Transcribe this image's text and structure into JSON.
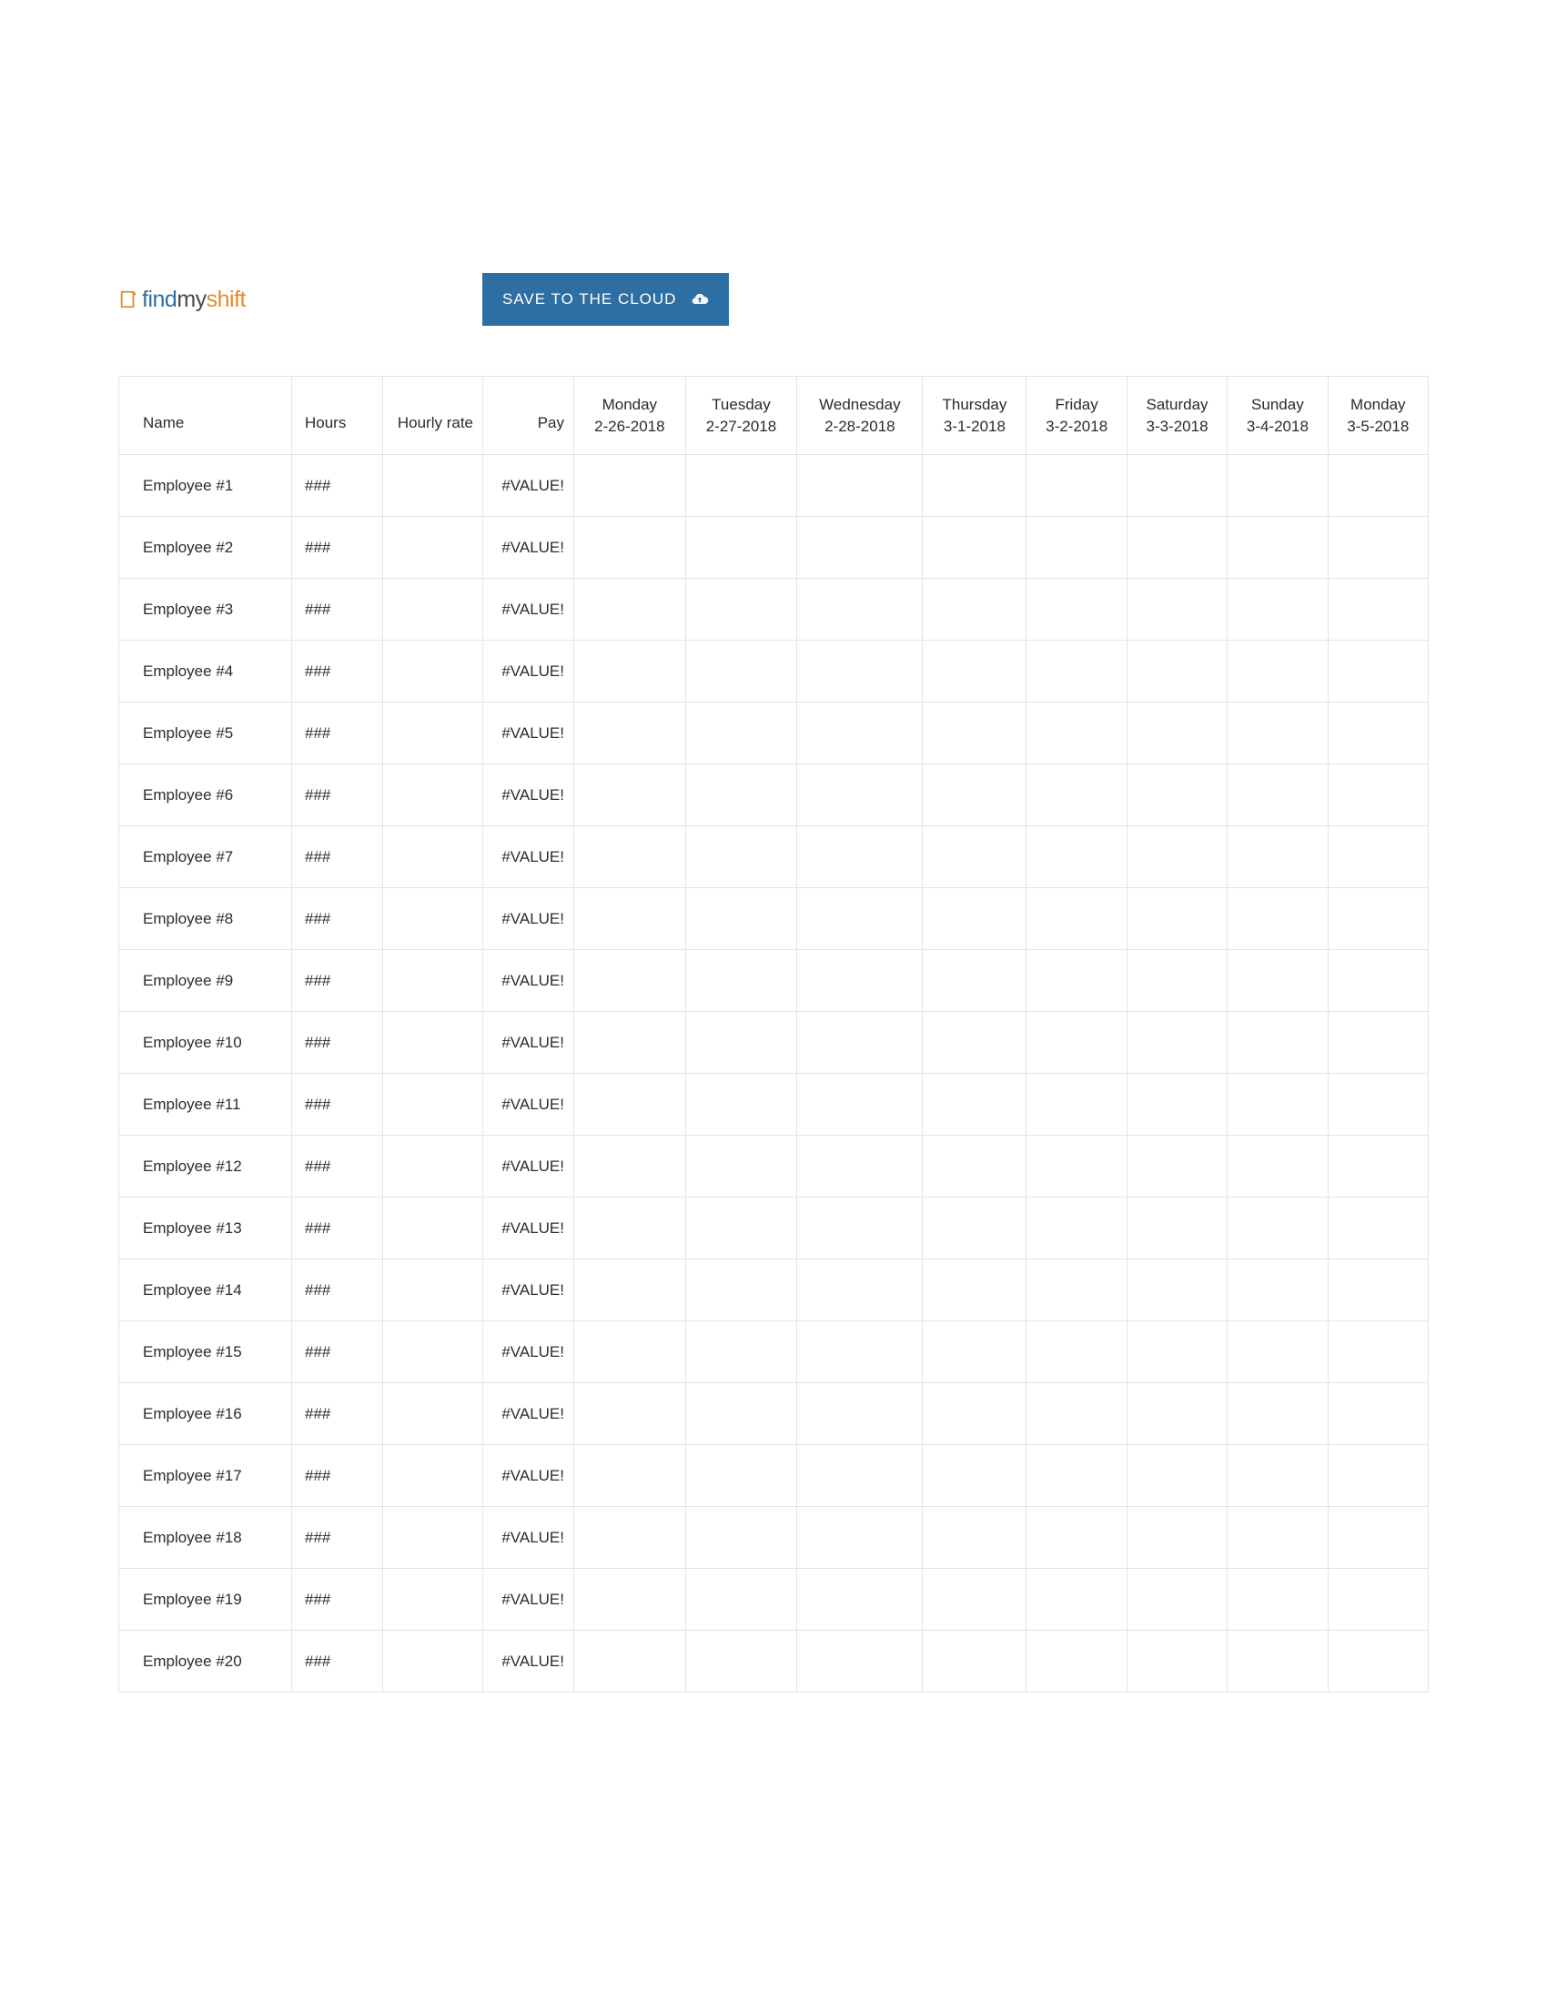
{
  "logo": {
    "part1": "find",
    "part2": "my",
    "part3": "shift"
  },
  "button": {
    "save_label": "SAVE TO THE CLOUD"
  },
  "table": {
    "headers": {
      "name": "Name",
      "hours": "Hours",
      "rate": "Hourly rate",
      "pay": "Pay"
    },
    "date_columns": [
      {
        "day": "Monday",
        "date": "2-26-2018"
      },
      {
        "day": "Tuesday",
        "date": "2-27-2018"
      },
      {
        "day": "Wednesday",
        "date": "2-28-2018"
      },
      {
        "day": "Thursday",
        "date": "3-1-2018"
      },
      {
        "day": "Friday",
        "date": "3-2-2018"
      },
      {
        "day": "Saturday",
        "date": "3-3-2018"
      },
      {
        "day": "Sunday",
        "date": "3-4-2018"
      },
      {
        "day": "Monday",
        "date": "3-5-2018"
      }
    ],
    "rows": [
      {
        "name": "Employee #1",
        "hours": "###",
        "rate": "",
        "pay": "#VALUE!"
      },
      {
        "name": "Employee #2",
        "hours": "###",
        "rate": "",
        "pay": "#VALUE!"
      },
      {
        "name": "Employee #3",
        "hours": "###",
        "rate": "",
        "pay": "#VALUE!"
      },
      {
        "name": "Employee #4",
        "hours": "###",
        "rate": "",
        "pay": "#VALUE!"
      },
      {
        "name": "Employee #5",
        "hours": "###",
        "rate": "",
        "pay": "#VALUE!"
      },
      {
        "name": "Employee #6",
        "hours": "###",
        "rate": "",
        "pay": "#VALUE!"
      },
      {
        "name": "Employee #7",
        "hours": "###",
        "rate": "",
        "pay": "#VALUE!"
      },
      {
        "name": "Employee #8",
        "hours": "###",
        "rate": "",
        "pay": "#VALUE!"
      },
      {
        "name": "Employee #9",
        "hours": "###",
        "rate": "",
        "pay": "#VALUE!"
      },
      {
        "name": "Employee #10",
        "hours": "###",
        "rate": "",
        "pay": "#VALUE!"
      },
      {
        "name": "Employee #11",
        "hours": "###",
        "rate": "",
        "pay": "#VALUE!"
      },
      {
        "name": "Employee #12",
        "hours": "###",
        "rate": "",
        "pay": "#VALUE!"
      },
      {
        "name": "Employee #13",
        "hours": "###",
        "rate": "",
        "pay": "#VALUE!"
      },
      {
        "name": "Employee #14",
        "hours": "###",
        "rate": "",
        "pay": "#VALUE!"
      },
      {
        "name": "Employee #15",
        "hours": "###",
        "rate": "",
        "pay": "#VALUE!"
      },
      {
        "name": "Employee #16",
        "hours": "###",
        "rate": "",
        "pay": "#VALUE!"
      },
      {
        "name": "Employee #17",
        "hours": "###",
        "rate": "",
        "pay": "#VALUE!"
      },
      {
        "name": "Employee #18",
        "hours": "###",
        "rate": "",
        "pay": "#VALUE!"
      },
      {
        "name": "Employee #19",
        "hours": "###",
        "rate": "",
        "pay": "#VALUE!"
      },
      {
        "name": "Employee #20",
        "hours": "###",
        "rate": "",
        "pay": "#VALUE!"
      }
    ]
  }
}
